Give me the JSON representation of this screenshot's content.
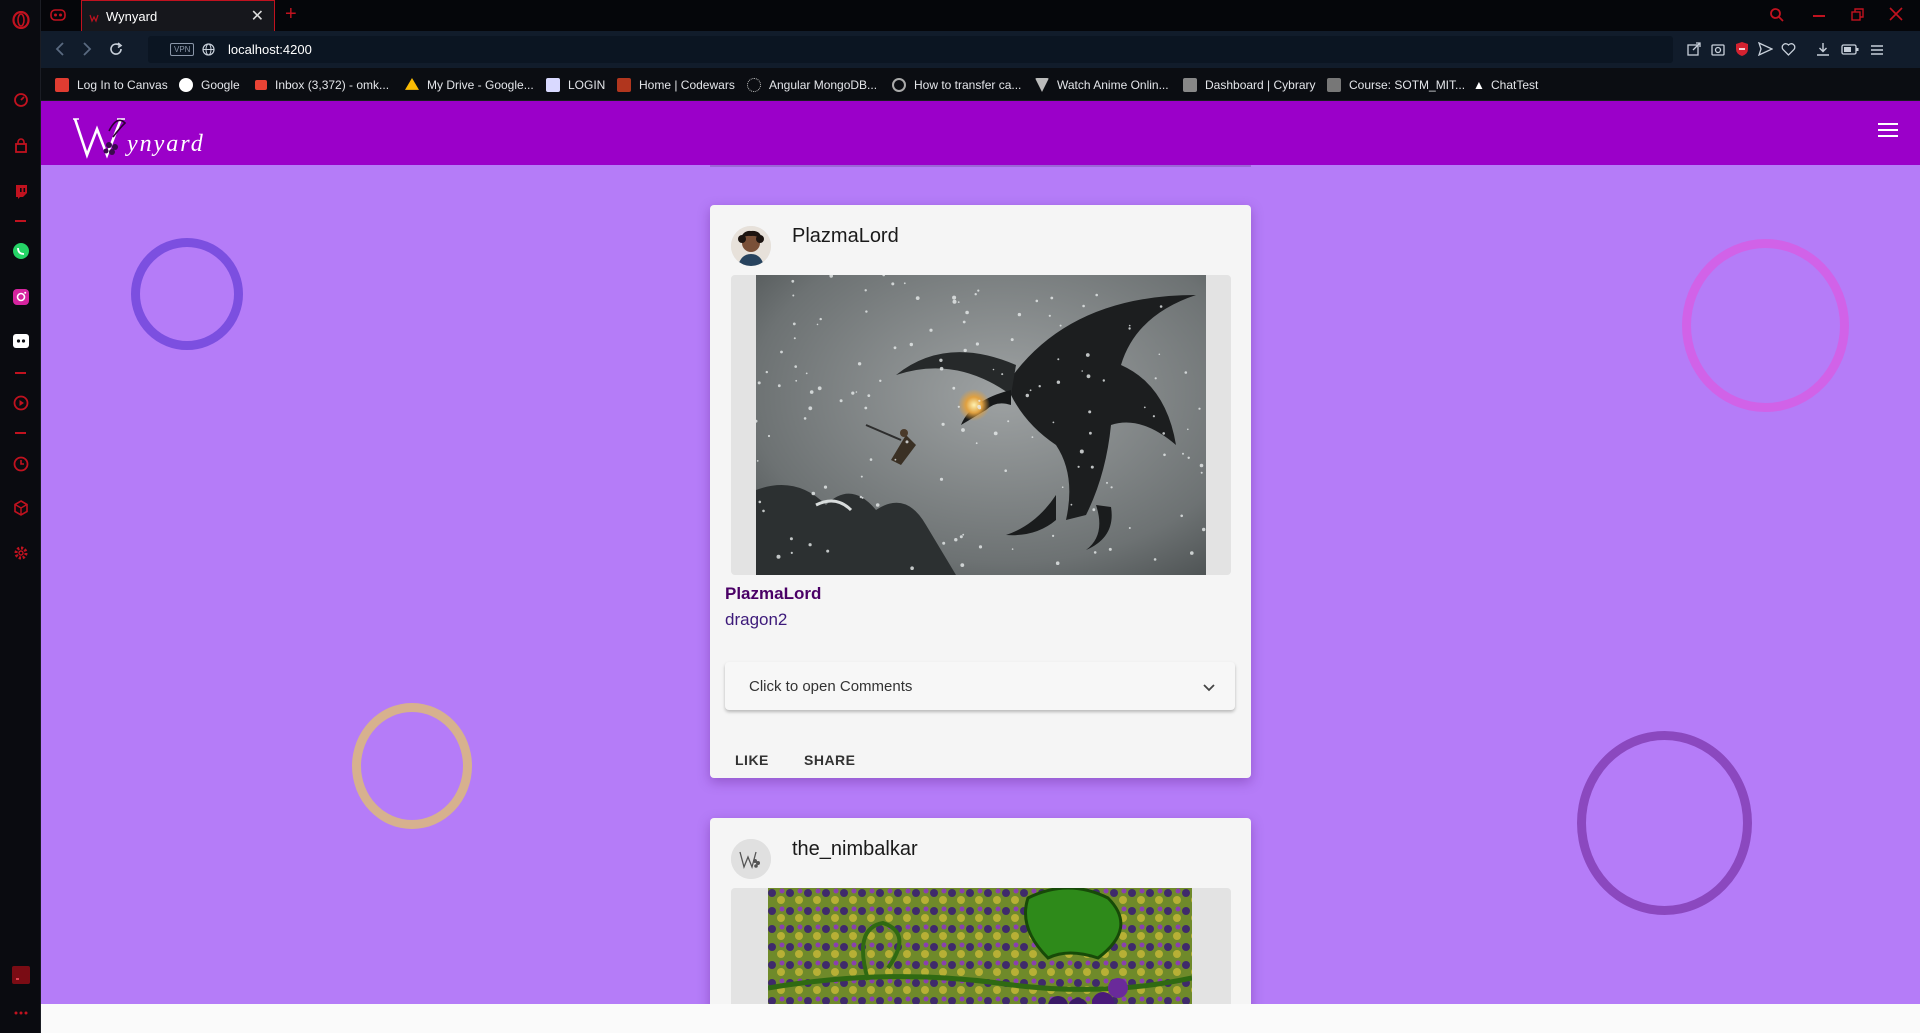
{
  "browser": {
    "tab": {
      "title": "Wynyard",
      "close": "✕"
    },
    "new_tab": "+",
    "url": "localhost:4200",
    "vpn_label": "VPN"
  },
  "bookmarks": [
    {
      "label": "Log In to Canvas",
      "icon": "canvas-icon",
      "color": "#e03c31"
    },
    {
      "label": "Google",
      "icon": "google-icon",
      "color": "#ffffff"
    },
    {
      "label": "Inbox (3,372) - omk...",
      "icon": "gmail-icon",
      "color": "#ea4335"
    },
    {
      "label": "My Drive - Google...",
      "icon": "drive-icon",
      "color": "#fbbc04"
    },
    {
      "label": "LOGIN",
      "icon": "login-icon",
      "color": "#d9d9ff"
    },
    {
      "label": "Home | Codewars",
      "icon": "codewars-icon",
      "color": "#b1361e"
    },
    {
      "label": "Angular MongoDB...",
      "icon": "angular-icon",
      "color": "#c3c3c3"
    },
    {
      "label": "How to transfer ca...",
      "icon": "github-icon",
      "color": "#aaaaaa"
    },
    {
      "label": "Watch Anime Onlin...",
      "icon": "anime-icon",
      "color": "#bbbbbb"
    },
    {
      "label": "Dashboard | Cybrary",
      "icon": "cybrary-icon",
      "color": "#888888"
    },
    {
      "label": "Course: SOTM_MIT...",
      "icon": "course-icon",
      "color": "#777777"
    },
    {
      "label": "ChatTest",
      "icon": "chattest-icon",
      "color": "#ffffff"
    }
  ],
  "app": {
    "name": "Wynyard",
    "colors": {
      "appbar": "#9b00c9",
      "background": "#b57cf8"
    }
  },
  "posts": [
    {
      "username": "PlazmaLord",
      "title": "PlazmaLord",
      "caption": "dragon2",
      "comments_label": "Click to open Comments",
      "like_label": "LIKE",
      "share_label": "SHARE"
    },
    {
      "username": "the_nimbalkar"
    }
  ]
}
